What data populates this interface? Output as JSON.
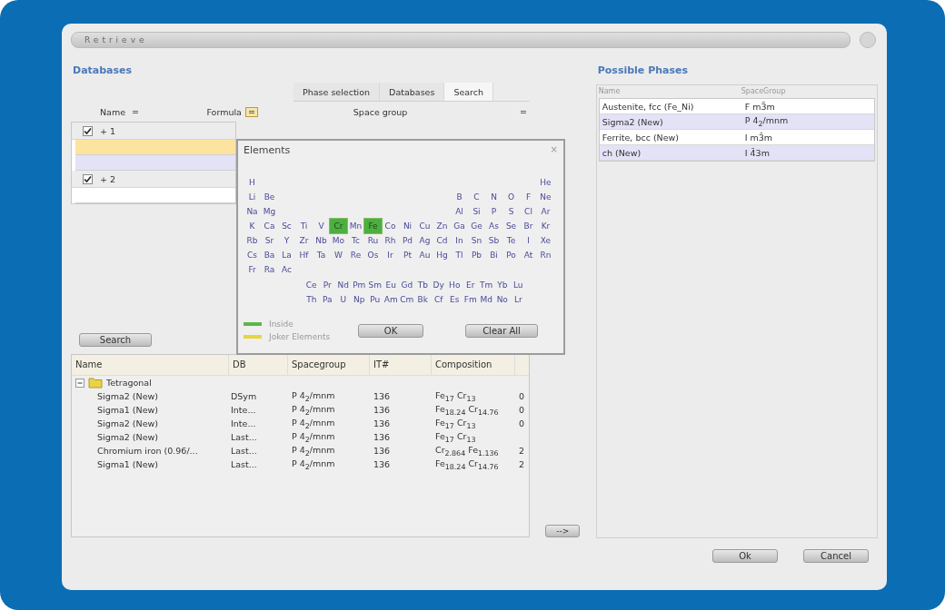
{
  "window": {
    "title": "Retrieve"
  },
  "databases": {
    "heading": "Databases",
    "tabs": [
      {
        "label": "Phase selection",
        "selected": false
      },
      {
        "label": "Databases",
        "selected": false
      },
      {
        "label": "Search",
        "selected": true
      }
    ],
    "columns": [
      {
        "label": "Name",
        "filter_active": false
      },
      {
        "label": "Formula",
        "filter_active": true
      },
      {
        "label": "Space group",
        "filter_active": false
      }
    ],
    "filters": [
      {
        "kind": "group",
        "checked": true,
        "label": "+ 1"
      },
      {
        "kind": "field",
        "color": "#fce3a0"
      },
      {
        "kind": "field",
        "color": "#e4e2f6"
      },
      {
        "kind": "group",
        "checked": true,
        "label": "+ 2"
      },
      {
        "kind": "field",
        "color": "#ffffff"
      }
    ],
    "search_button": "Search"
  },
  "elements_dialog": {
    "title": "Elements",
    "close": "×",
    "rows": [
      {
        "left": [
          {
            "symbol": "H",
            "selected": false
          }
        ],
        "right": [
          {
            "symbol": "He",
            "selected": false
          }
        ]
      },
      {
        "left": [
          {
            "symbol": "Li",
            "selected": false
          },
          {
            "symbol": "Be",
            "selected": false
          }
        ],
        "right": [
          {
            "symbol": "B",
            "selected": false
          },
          {
            "symbol": "C",
            "selected": false
          },
          {
            "symbol": "N",
            "selected": false
          },
          {
            "symbol": "O",
            "selected": false
          },
          {
            "symbol": "F",
            "selected": false
          },
          {
            "symbol": "Ne",
            "selected": false
          }
        ]
      },
      {
        "left": [
          {
            "symbol": "Na",
            "selected": false
          },
          {
            "symbol": "Mg",
            "selected": false
          }
        ],
        "right": [
          {
            "symbol": "Al",
            "selected": false
          },
          {
            "symbol": "Si",
            "selected": false
          },
          {
            "symbol": "P",
            "selected": false
          },
          {
            "symbol": "S",
            "selected": false
          },
          {
            "symbol": "Cl",
            "selected": false
          },
          {
            "symbol": "Ar",
            "selected": false
          }
        ]
      },
      {
        "left": [
          {
            "symbol": "K",
            "selected": false
          },
          {
            "symbol": "Ca",
            "selected": false
          },
          {
            "symbol": "Sc",
            "selected": false
          },
          {
            "symbol": "Ti",
            "selected": false
          },
          {
            "symbol": "V",
            "selected": false
          },
          {
            "symbol": "Cr",
            "selected": true
          },
          {
            "symbol": "Mn",
            "selected": false
          },
          {
            "symbol": "Fe",
            "selected": true
          },
          {
            "symbol": "Co",
            "selected": false
          },
          {
            "symbol": "Ni",
            "selected": false
          },
          {
            "symbol": "Cu",
            "selected": false
          },
          {
            "symbol": "Zn",
            "selected": false
          },
          {
            "symbol": "Ga",
            "selected": false
          },
          {
            "symbol": "Ge",
            "selected": false
          },
          {
            "symbol": "As",
            "selected": false
          },
          {
            "symbol": "Se",
            "selected": false
          },
          {
            "symbol": "Br",
            "selected": false
          },
          {
            "symbol": "Kr",
            "selected": false
          }
        ],
        "right": []
      },
      {
        "left": [
          {
            "symbol": "Rb",
            "selected": false
          },
          {
            "symbol": "Sr",
            "selected": false
          },
          {
            "symbol": "Y",
            "selected": false
          },
          {
            "symbol": "Zr",
            "selected": false
          },
          {
            "symbol": "Nb",
            "selected": false
          },
          {
            "symbol": "Mo",
            "selected": false
          },
          {
            "symbol": "Tc",
            "selected": false
          },
          {
            "symbol": "Ru",
            "selected": false
          },
          {
            "symbol": "Rh",
            "selected": false
          },
          {
            "symbol": "Pd",
            "selected": false
          },
          {
            "symbol": "Ag",
            "selected": false
          },
          {
            "symbol": "Cd",
            "selected": false
          },
          {
            "symbol": "In",
            "selected": false
          },
          {
            "symbol": "Sn",
            "selected": false
          },
          {
            "symbol": "Sb",
            "selected": false
          },
          {
            "symbol": "Te",
            "selected": false
          },
          {
            "symbol": "I",
            "selected": false
          },
          {
            "symbol": "Xe",
            "selected": false
          }
        ],
        "right": []
      },
      {
        "left": [
          {
            "symbol": "Cs",
            "selected": false
          },
          {
            "symbol": "Ba",
            "selected": false
          },
          {
            "symbol": "La",
            "selected": false
          },
          {
            "symbol": "Hf",
            "selected": false
          },
          {
            "symbol": "Ta",
            "selected": false
          },
          {
            "symbol": "W",
            "selected": false
          },
          {
            "symbol": "Re",
            "selected": false
          },
          {
            "symbol": "Os",
            "selected": false
          },
          {
            "symbol": "Ir",
            "selected": false
          },
          {
            "symbol": "Pt",
            "selected": false
          },
          {
            "symbol": "Au",
            "selected": false
          },
          {
            "symbol": "Hg",
            "selected": false
          },
          {
            "symbol": "Tl",
            "selected": false
          },
          {
            "symbol": "Pb",
            "selected": false
          },
          {
            "symbol": "Bi",
            "selected": false
          },
          {
            "symbol": "Po",
            "selected": false
          },
          {
            "symbol": "At",
            "selected": false
          },
          {
            "symbol": "Rn",
            "selected": false
          }
        ],
        "right": []
      },
      {
        "left": [
          {
            "symbol": "Fr",
            "selected": false
          },
          {
            "symbol": "Ra",
            "selected": false
          },
          {
            "symbol": "Ac",
            "selected": false
          }
        ],
        "right": []
      }
    ],
    "f_rows": [
      [
        {
          "symbol": "Ce",
          "selected": false
        },
        {
          "symbol": "Pr",
          "selected": false
        },
        {
          "symbol": "Nd",
          "selected": false
        },
        {
          "symbol": "Pm",
          "selected": false
        },
        {
          "symbol": "Sm",
          "selected": false
        },
        {
          "symbol": "Eu",
          "selected": false
        },
        {
          "symbol": "Gd",
          "selected": false
        },
        {
          "symbol": "Tb",
          "selected": false
        },
        {
          "symbol": "Dy",
          "selected": false
        },
        {
          "symbol": "Ho",
          "selected": false
        },
        {
          "symbol": "Er",
          "selected": false
        },
        {
          "symbol": "Tm",
          "selected": false
        },
        {
          "symbol": "Yb",
          "selected": false
        },
        {
          "symbol": "Lu",
          "selected": false
        }
      ],
      [
        {
          "symbol": "Th",
          "selected": false
        },
        {
          "symbol": "Pa",
          "selected": false
        },
        {
          "symbol": "U",
          "selected": false
        },
        {
          "symbol": "Np",
          "selected": false
        },
        {
          "symbol": "Pu",
          "selected": false
        },
        {
          "symbol": "Am",
          "selected": false
        },
        {
          "symbol": "Cm",
          "selected": false
        },
        {
          "symbol": "Bk",
          "selected": false
        },
        {
          "symbol": "Cf",
          "selected": false
        },
        {
          "symbol": "Es",
          "selected": false
        },
        {
          "symbol": "Fm",
          "selected": false
        },
        {
          "symbol": "Md",
          "selected": false
        },
        {
          "symbol": "No",
          "selected": false
        },
        {
          "symbol": "Lr",
          "selected": false
        }
      ]
    ],
    "legend": [
      {
        "label": "Inside",
        "color": "#5cb848"
      },
      {
        "label": "Joker Elements",
        "color": "#e8d440"
      }
    ],
    "buttons": [
      "OK",
      "Clear All"
    ]
  },
  "results": {
    "columns": [
      "Name",
      "DB",
      "Spacegroup",
      "IT#",
      "Composition"
    ],
    "groups": [
      {
        "label": "Tetragonal",
        "expanded": true,
        "children": [
          {
            "name": "Sigma2 (New)",
            "db": "DSym",
            "spacegroup": "P 4$_{2}$/mnm",
            "it": "136",
            "composition": "Fe$_{17}$ Cr$_{13}$",
            "column_6": "0"
          },
          {
            "name": "Sigma1 (New)",
            "db": "Inte...",
            "spacegroup": "P 4$_{2}$/mnm",
            "it": "136",
            "composition": "Fe$_{18.24}$ Cr$_{14.76}$",
            "column_6": "0"
          },
          {
            "name": "Sigma2 (New)",
            "db": "Inte...",
            "spacegroup": "P 4$_{2}$/mnm",
            "it": "136",
            "composition": "Fe$_{17}$ Cr$_{13}$",
            "column_6": "0"
          },
          {
            "name": "Sigma2 (New)",
            "db": "Last...",
            "spacegroup": "P 4$_{2}$/mnm",
            "it": "136",
            "composition": "Fe$_{17}$ Cr$_{13}$"
          },
          {
            "name": "Chromium iron (0.96/...",
            "db": "Last...",
            "spacegroup": "P 4$_{2}$/mnm",
            "it": "136",
            "composition": "Cr$_{2.864}$ Fe$_{1.136}$",
            "column_6": "2"
          },
          {
            "name": "Sigma1 (New)",
            "db": "Last...",
            "spacegroup": "P 4$_{2}$/mnm",
            "it": "136",
            "composition": "Fe$_{18.24}$ Cr$_{14.76}$",
            "column_6": "2"
          }
        ]
      }
    ]
  },
  "transfer_button": "-->",
  "possible_phases": {
    "heading": "Possible Phases",
    "columns": [
      "Name",
      "SpaceGroup"
    ],
    "rows": [
      {
        "name": "Austenite, fcc (Fe_Ni)",
        "spacegroup": "F m3̄m"
      },
      {
        "name": "Sigma2 (New)",
        "spacegroup": "P 4$_{2}$/mnm"
      },
      {
        "name": "Ferrite, bcc (New)",
        "spacegroup": "I m3̄m"
      },
      {
        "name": "ch (New)",
        "spacegroup": "I 4̄3m"
      }
    ]
  },
  "buttons": [
    "Ok",
    "Cancel"
  ]
}
